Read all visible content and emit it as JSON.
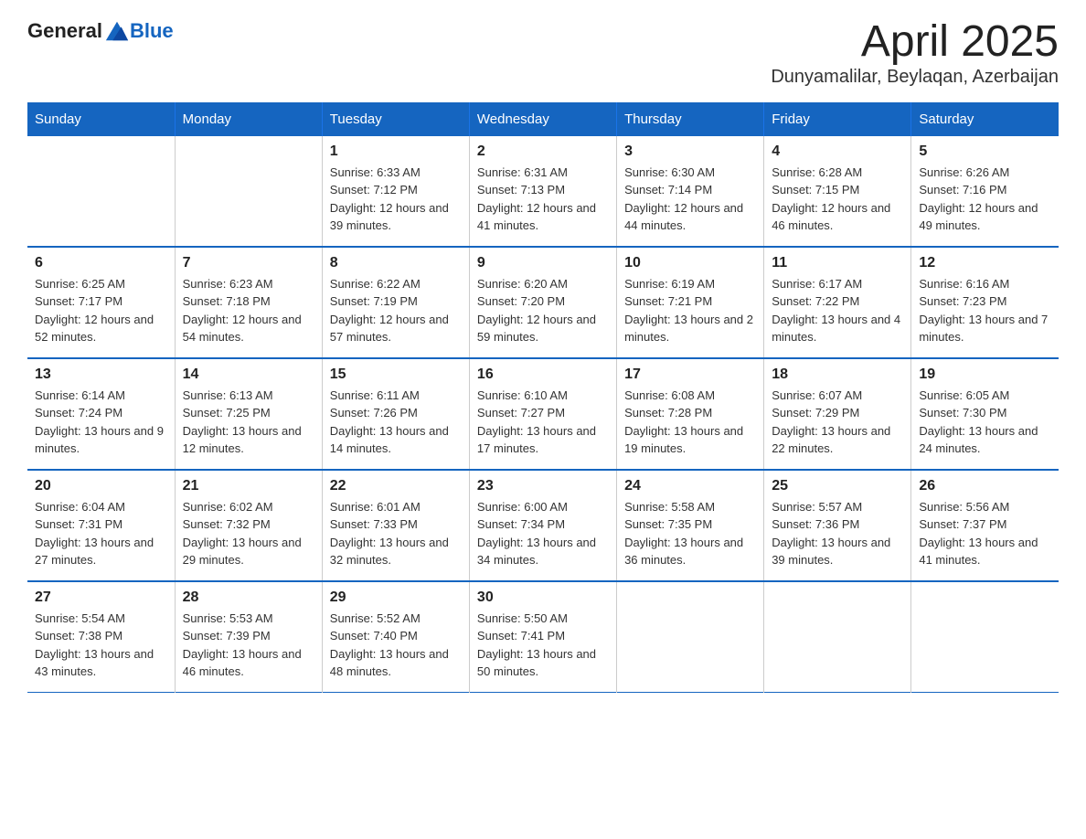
{
  "logo": {
    "text_general": "General",
    "text_blue": "Blue"
  },
  "title": "April 2025",
  "subtitle": "Dunyamalilar, Beylaqan, Azerbaijan",
  "days_of_week": [
    "Sunday",
    "Monday",
    "Tuesday",
    "Wednesday",
    "Thursday",
    "Friday",
    "Saturday"
  ],
  "weeks": [
    [
      {
        "day": "",
        "sunrise": "",
        "sunset": "",
        "daylight": ""
      },
      {
        "day": "",
        "sunrise": "",
        "sunset": "",
        "daylight": ""
      },
      {
        "day": "1",
        "sunrise": "Sunrise: 6:33 AM",
        "sunset": "Sunset: 7:12 PM",
        "daylight": "Daylight: 12 hours and 39 minutes."
      },
      {
        "day": "2",
        "sunrise": "Sunrise: 6:31 AM",
        "sunset": "Sunset: 7:13 PM",
        "daylight": "Daylight: 12 hours and 41 minutes."
      },
      {
        "day": "3",
        "sunrise": "Sunrise: 6:30 AM",
        "sunset": "Sunset: 7:14 PM",
        "daylight": "Daylight: 12 hours and 44 minutes."
      },
      {
        "day": "4",
        "sunrise": "Sunrise: 6:28 AM",
        "sunset": "Sunset: 7:15 PM",
        "daylight": "Daylight: 12 hours and 46 minutes."
      },
      {
        "day": "5",
        "sunrise": "Sunrise: 6:26 AM",
        "sunset": "Sunset: 7:16 PM",
        "daylight": "Daylight: 12 hours and 49 minutes."
      }
    ],
    [
      {
        "day": "6",
        "sunrise": "Sunrise: 6:25 AM",
        "sunset": "Sunset: 7:17 PM",
        "daylight": "Daylight: 12 hours and 52 minutes."
      },
      {
        "day": "7",
        "sunrise": "Sunrise: 6:23 AM",
        "sunset": "Sunset: 7:18 PM",
        "daylight": "Daylight: 12 hours and 54 minutes."
      },
      {
        "day": "8",
        "sunrise": "Sunrise: 6:22 AM",
        "sunset": "Sunset: 7:19 PM",
        "daylight": "Daylight: 12 hours and 57 minutes."
      },
      {
        "day": "9",
        "sunrise": "Sunrise: 6:20 AM",
        "sunset": "Sunset: 7:20 PM",
        "daylight": "Daylight: 12 hours and 59 minutes."
      },
      {
        "day": "10",
        "sunrise": "Sunrise: 6:19 AM",
        "sunset": "Sunset: 7:21 PM",
        "daylight": "Daylight: 13 hours and 2 minutes."
      },
      {
        "day": "11",
        "sunrise": "Sunrise: 6:17 AM",
        "sunset": "Sunset: 7:22 PM",
        "daylight": "Daylight: 13 hours and 4 minutes."
      },
      {
        "day": "12",
        "sunrise": "Sunrise: 6:16 AM",
        "sunset": "Sunset: 7:23 PM",
        "daylight": "Daylight: 13 hours and 7 minutes."
      }
    ],
    [
      {
        "day": "13",
        "sunrise": "Sunrise: 6:14 AM",
        "sunset": "Sunset: 7:24 PM",
        "daylight": "Daylight: 13 hours and 9 minutes."
      },
      {
        "day": "14",
        "sunrise": "Sunrise: 6:13 AM",
        "sunset": "Sunset: 7:25 PM",
        "daylight": "Daylight: 13 hours and 12 minutes."
      },
      {
        "day": "15",
        "sunrise": "Sunrise: 6:11 AM",
        "sunset": "Sunset: 7:26 PM",
        "daylight": "Daylight: 13 hours and 14 minutes."
      },
      {
        "day": "16",
        "sunrise": "Sunrise: 6:10 AM",
        "sunset": "Sunset: 7:27 PM",
        "daylight": "Daylight: 13 hours and 17 minutes."
      },
      {
        "day": "17",
        "sunrise": "Sunrise: 6:08 AM",
        "sunset": "Sunset: 7:28 PM",
        "daylight": "Daylight: 13 hours and 19 minutes."
      },
      {
        "day": "18",
        "sunrise": "Sunrise: 6:07 AM",
        "sunset": "Sunset: 7:29 PM",
        "daylight": "Daylight: 13 hours and 22 minutes."
      },
      {
        "day": "19",
        "sunrise": "Sunrise: 6:05 AM",
        "sunset": "Sunset: 7:30 PM",
        "daylight": "Daylight: 13 hours and 24 minutes."
      }
    ],
    [
      {
        "day": "20",
        "sunrise": "Sunrise: 6:04 AM",
        "sunset": "Sunset: 7:31 PM",
        "daylight": "Daylight: 13 hours and 27 minutes."
      },
      {
        "day": "21",
        "sunrise": "Sunrise: 6:02 AM",
        "sunset": "Sunset: 7:32 PM",
        "daylight": "Daylight: 13 hours and 29 minutes."
      },
      {
        "day": "22",
        "sunrise": "Sunrise: 6:01 AM",
        "sunset": "Sunset: 7:33 PM",
        "daylight": "Daylight: 13 hours and 32 minutes."
      },
      {
        "day": "23",
        "sunrise": "Sunrise: 6:00 AM",
        "sunset": "Sunset: 7:34 PM",
        "daylight": "Daylight: 13 hours and 34 minutes."
      },
      {
        "day": "24",
        "sunrise": "Sunrise: 5:58 AM",
        "sunset": "Sunset: 7:35 PM",
        "daylight": "Daylight: 13 hours and 36 minutes."
      },
      {
        "day": "25",
        "sunrise": "Sunrise: 5:57 AM",
        "sunset": "Sunset: 7:36 PM",
        "daylight": "Daylight: 13 hours and 39 minutes."
      },
      {
        "day": "26",
        "sunrise": "Sunrise: 5:56 AM",
        "sunset": "Sunset: 7:37 PM",
        "daylight": "Daylight: 13 hours and 41 minutes."
      }
    ],
    [
      {
        "day": "27",
        "sunrise": "Sunrise: 5:54 AM",
        "sunset": "Sunset: 7:38 PM",
        "daylight": "Daylight: 13 hours and 43 minutes."
      },
      {
        "day": "28",
        "sunrise": "Sunrise: 5:53 AM",
        "sunset": "Sunset: 7:39 PM",
        "daylight": "Daylight: 13 hours and 46 minutes."
      },
      {
        "day": "29",
        "sunrise": "Sunrise: 5:52 AM",
        "sunset": "Sunset: 7:40 PM",
        "daylight": "Daylight: 13 hours and 48 minutes."
      },
      {
        "day": "30",
        "sunrise": "Sunrise: 5:50 AM",
        "sunset": "Sunset: 7:41 PM",
        "daylight": "Daylight: 13 hours and 50 minutes."
      },
      {
        "day": "",
        "sunrise": "",
        "sunset": "",
        "daylight": ""
      },
      {
        "day": "",
        "sunrise": "",
        "sunset": "",
        "daylight": ""
      },
      {
        "day": "",
        "sunrise": "",
        "sunset": "",
        "daylight": ""
      }
    ]
  ]
}
